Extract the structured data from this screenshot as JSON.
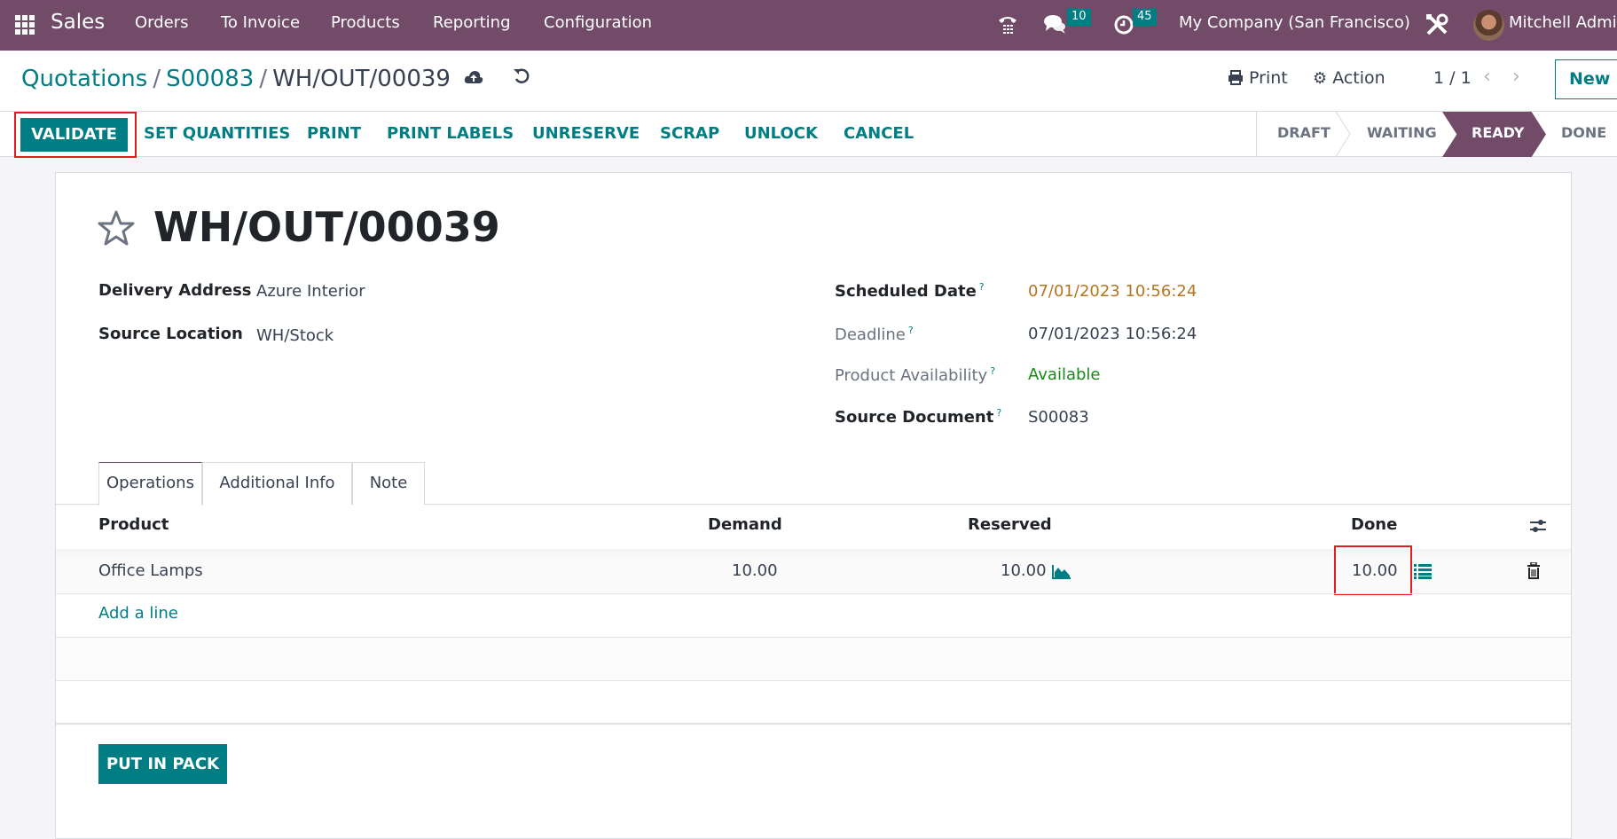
{
  "navbar": {
    "app_name": "Sales",
    "menu": [
      "Orders",
      "To Invoice",
      "Products",
      "Reporting",
      "Configuration"
    ],
    "messages_count": "10",
    "activities_count": "45",
    "company": "My Company (San Francisco)",
    "user": "Mitchell Admi"
  },
  "breadcrumb": {
    "items": [
      "Quotations",
      "S00083"
    ],
    "current": "WH/OUT/00039",
    "separator": "/"
  },
  "control_panel": {
    "print_label": "Print",
    "action_label": "Action",
    "pager": "1 / 1",
    "new_label": "New"
  },
  "header_buttons": {
    "validate": "VALIDATE",
    "set_quantities": "SET QUANTITIES",
    "print": "PRINT",
    "print_labels": "PRINT LABELS",
    "unreserve": "UNRESERVE",
    "scrap": "SCRAP",
    "unlock": "UNLOCK",
    "cancel": "CANCEL"
  },
  "status": {
    "stages": [
      "DRAFT",
      "WAITING",
      "READY",
      "DONE"
    ],
    "current": "READY"
  },
  "record": {
    "title": "WH/OUT/00039",
    "left_fields": [
      {
        "label": "Delivery Address",
        "value": "Azure Interior"
      },
      {
        "label": "Source Location",
        "value": "WH/Stock"
      }
    ],
    "right_fields": [
      {
        "label": "Scheduled Date",
        "help": "?",
        "value": "07/01/2023 10:56:24"
      },
      {
        "label": "Deadline",
        "help": "?",
        "value": "07/01/2023 10:56:24"
      },
      {
        "label": "Product Availability",
        "help": "?",
        "value": "Available"
      },
      {
        "label": "Source Document",
        "help": "?",
        "value": "S00083"
      }
    ]
  },
  "tabs": [
    "Operations",
    "Additional Info",
    "Note"
  ],
  "table": {
    "columns": [
      "Product",
      "Demand",
      "Reserved",
      "Done"
    ],
    "rows": [
      {
        "product": "Office Lamps",
        "demand": "10.00",
        "reserved": "10.00",
        "done": "10.00"
      }
    ],
    "add_line": "Add a line"
  },
  "footer_button": "PUT IN PACK",
  "colors": {
    "brand": "#714b67",
    "accent": "#017e84",
    "highlight": "#e11d1d",
    "scheduled_date": "#b5751e",
    "available": "#178a17"
  }
}
